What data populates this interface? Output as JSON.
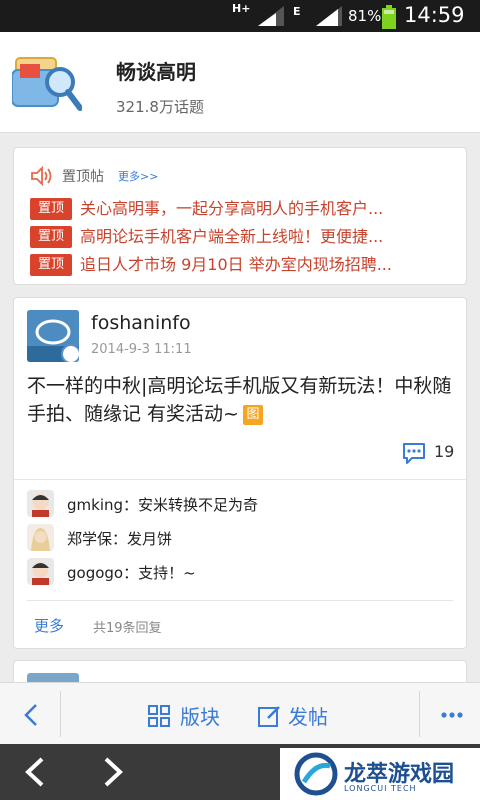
{
  "status_bar": {
    "network_type": "H+",
    "network_type_2": "E",
    "battery_percent": "81%",
    "time": "14:59"
  },
  "header": {
    "title": "畅谈高明",
    "topic_count": "321.8万话题"
  },
  "pinned": {
    "label": "置顶帖",
    "more": "更多>>",
    "tag": "置顶",
    "items": [
      {
        "text": "关心高明事，一起分享高明人的手机客户..."
      },
      {
        "text": "高明论坛手机客户端全新上线啦！更便捷..."
      },
      {
        "text": "追日人才市场 9月10日 举办室内现场招聘..."
      }
    ]
  },
  "post": {
    "author": "foshaninfo",
    "date": "2014-9-3 11:11",
    "content": "不一样的中秋|高明论坛手机版又有新玩法！中秋随手拍、随缘记 有奖活动~",
    "image_tag": "图",
    "comment_count": "19",
    "replies": [
      {
        "text": "gmking：安米转换不足为奇"
      },
      {
        "text": "郑学保：发月饼"
      },
      {
        "text": "gogogo：支持！~"
      }
    ],
    "more": "更多",
    "total_replies": "共19条回复"
  },
  "toolbar": {
    "board_label": "版块",
    "compose_label": "发帖"
  },
  "watermark": {
    "text": "龙萃游戏园",
    "sub": "LONGCUI TECH"
  },
  "colors": {
    "accent_blue": "#3a7bd5",
    "pin_red": "#d9432c",
    "image_tag": "#f4a623"
  }
}
